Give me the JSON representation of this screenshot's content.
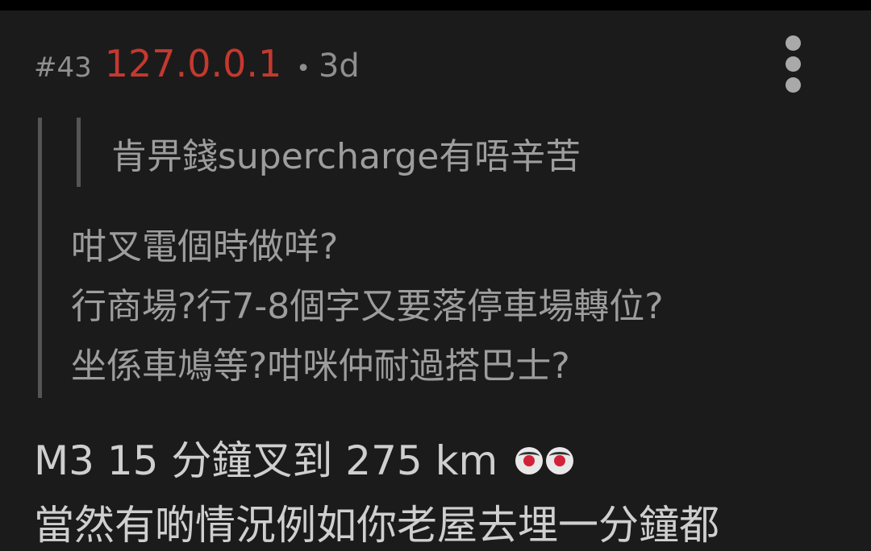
{
  "post": {
    "floor": "#43",
    "username": "127.0.0.1",
    "separator": "•",
    "age": "3d"
  },
  "nested_quote": "肯畀錢supercharge有唔辛苦",
  "quote_lines": [
    "咁叉電個時做咩?",
    "行商場?行7-8個字又要落停車場轉位?",
    "坐係車鳩等?咁咪仲耐過搭巴士?"
  ],
  "reply": {
    "text": "M3 15 分鐘叉到 275 km",
    "emojis": [
      "clown-emoji",
      "clown-emoji"
    ],
    "next_line_partial": "當然有啲情況例如你老屋去埋一分鐘都"
  },
  "icons": {
    "more": "more-vertical-icon"
  },
  "colors": {
    "background": "#1b1b1b",
    "username": "#c4392f",
    "muted": "#8f8f8f"
  }
}
